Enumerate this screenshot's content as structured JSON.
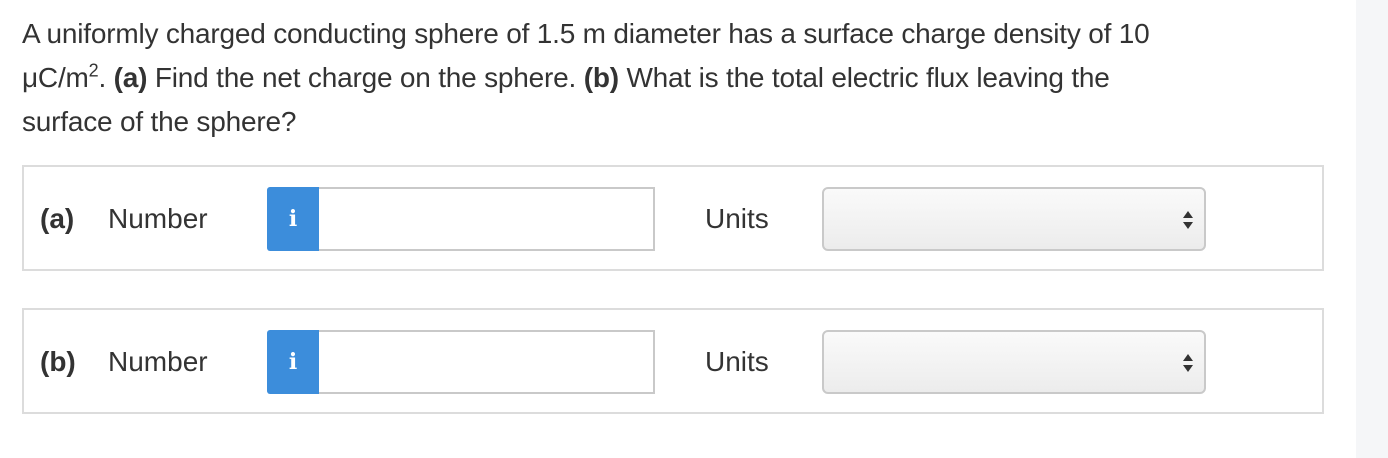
{
  "question": {
    "line1": "A uniformly charged conducting sphere of 1.5 m diameter has a surface charge density of 10",
    "unit_base": "μC/m",
    "unit_exp": "2",
    "after_unit": ". ",
    "part_a_tag": "(a)",
    "part_a_text": " Find the net charge on the sphere. ",
    "part_b_tag": "(b)",
    "part_b_text": " What is the total electric flux leaving the",
    "line3": "surface of the sphere?"
  },
  "rows": [
    {
      "part_label": "(a)",
      "number_label": "Number",
      "info_icon": "i",
      "number_value": "",
      "units_label": "Units",
      "units_selected": ""
    },
    {
      "part_label": "(b)",
      "number_label": "Number",
      "info_icon": "i",
      "number_value": "",
      "units_label": "Units",
      "units_selected": ""
    }
  ],
  "colors": {
    "info_button": "#3c8ddb",
    "border": "#dcdcdc",
    "text": "#333333"
  },
  "icons": {
    "info": "info-icon",
    "select_arrows": "up-down-arrows-icon"
  }
}
